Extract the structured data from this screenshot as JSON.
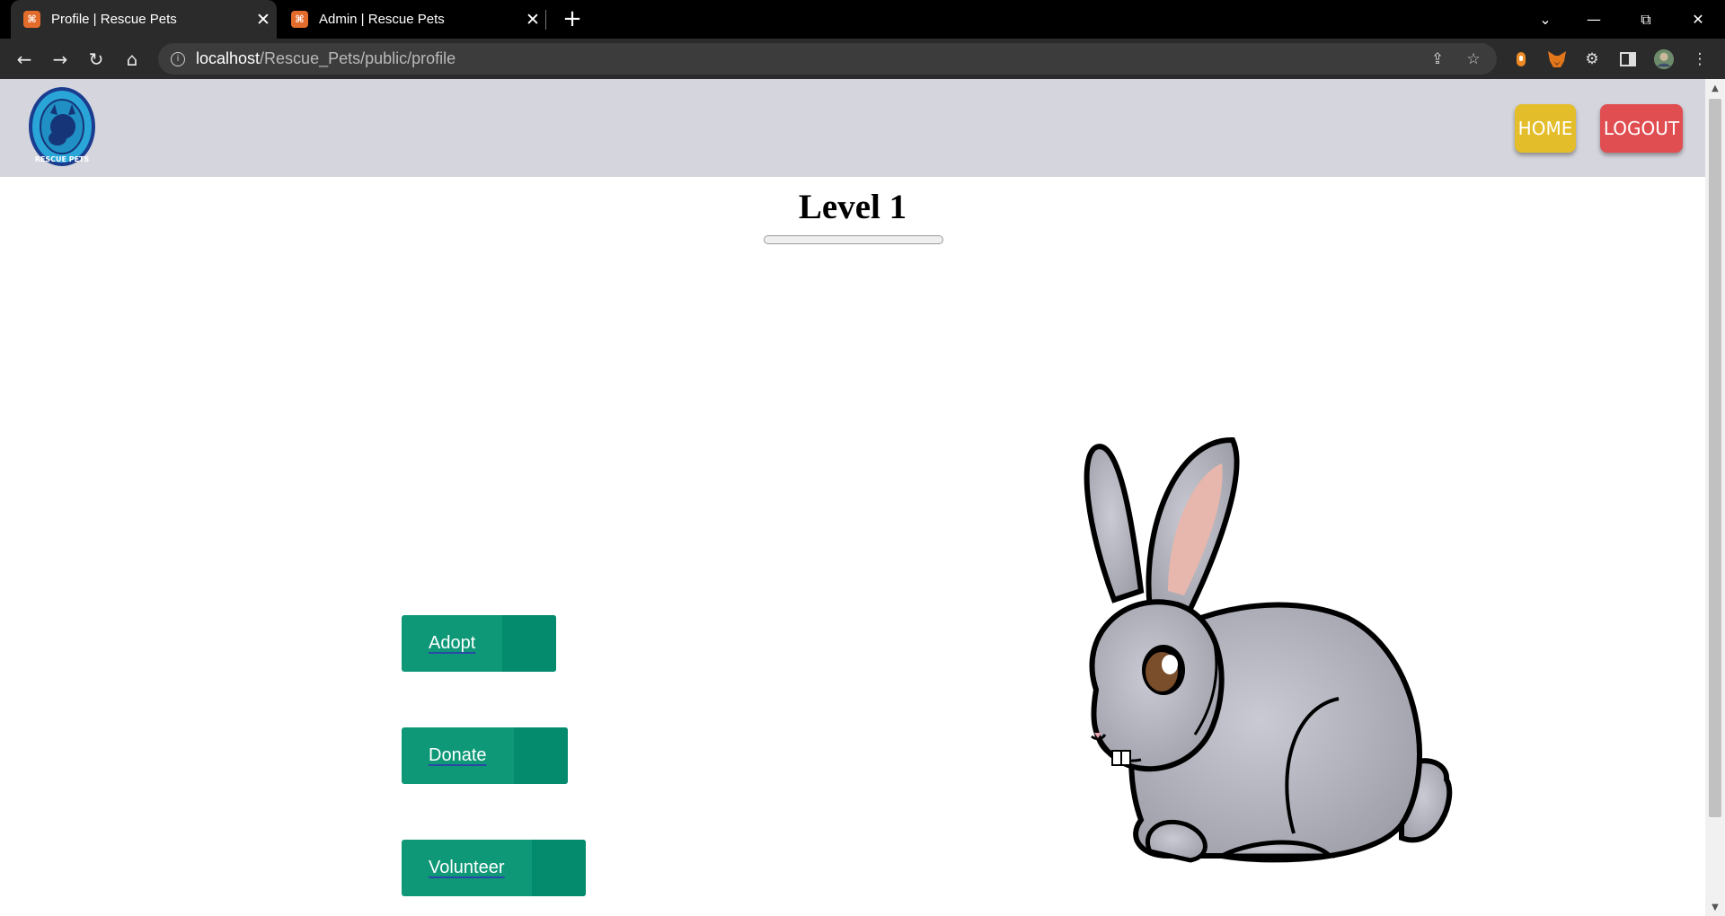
{
  "browser": {
    "tabs": [
      {
        "title": "Profile | Rescue Pets",
        "favicon": "xampp-icon",
        "active": true
      },
      {
        "title": "Admin | Rescue Pets",
        "favicon": "xampp-icon",
        "active": false
      }
    ],
    "url_host": "localhost",
    "url_path": "/Rescue_Pets/public/profile"
  },
  "header": {
    "logo_text": "RESCUE PETS",
    "home_label": "HOME",
    "logout_label": "LOGOUT",
    "colors": {
      "header_bg": "#d5d5dd",
      "home": "#e4bd2a",
      "logout": "#e04e52"
    }
  },
  "profile": {
    "level_title": "Level 1",
    "progress_fraction": 0,
    "image": "gray-rabbit-illustration"
  },
  "actions": [
    {
      "label": "Adopt"
    },
    {
      "label": "Donate"
    },
    {
      "label": "Volunteer"
    }
  ],
  "colors": {
    "action_button": "#0e9878",
    "action_button_tail": "#048a6d"
  }
}
